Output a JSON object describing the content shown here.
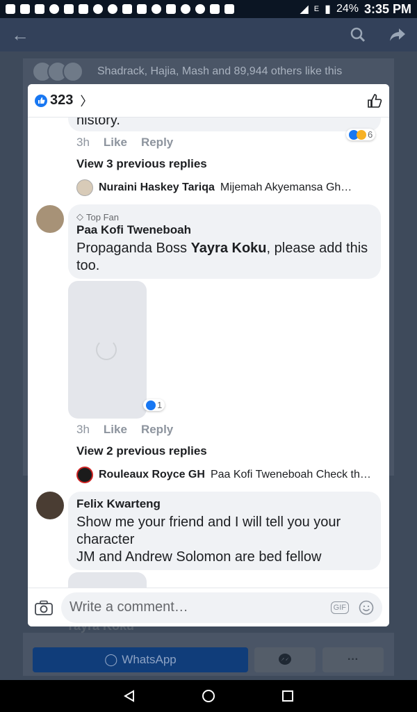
{
  "status_bar": {
    "battery": "24%",
    "time": "3:35 PM",
    "network": "E"
  },
  "background": {
    "likes_text": "Shadrack, Hajia, Mash and 89,944 others like this",
    "bottom_name": "Yayra Koku",
    "whatsapp_label": "WhatsApp",
    "more_label": "···"
  },
  "modal": {
    "reaction_count": "323",
    "comments": [
      {
        "partial_text": "history.",
        "time": "3h",
        "like": "Like",
        "reply": "Reply",
        "reaction_count": "6",
        "view_replies": "View 3 previous replies",
        "last_reply_name": "Nuraini Haskey Tariqa",
        "last_reply_text": "Mijemah Akyemansa Gh…"
      },
      {
        "badge": "Top Fan",
        "name": "Paa Kofi Tweneboah",
        "text_before": "Propaganda Boss ",
        "text_bold": "Yayra Koku",
        "text_after": ", please add this too.",
        "time": "3h",
        "like": "Like",
        "reply": "Reply",
        "reaction_count": "1",
        "view_replies": "View 2 previous replies",
        "last_reply_name": "Rouleaux Royce GH",
        "last_reply_text": "Paa Kofi Tweneboah Check th…"
      },
      {
        "name": "Felix Kwarteng",
        "text": "Show me your friend and I will tell you your character\nJM and Andrew Solomon are bed fellow"
      }
    ],
    "composer": {
      "placeholder": "Write a comment…",
      "gif_label": "GIF"
    }
  },
  "colors": {
    "facebook_blue": "#1877f2",
    "bubble": "#f0f2f5",
    "muted": "#8d949e"
  }
}
